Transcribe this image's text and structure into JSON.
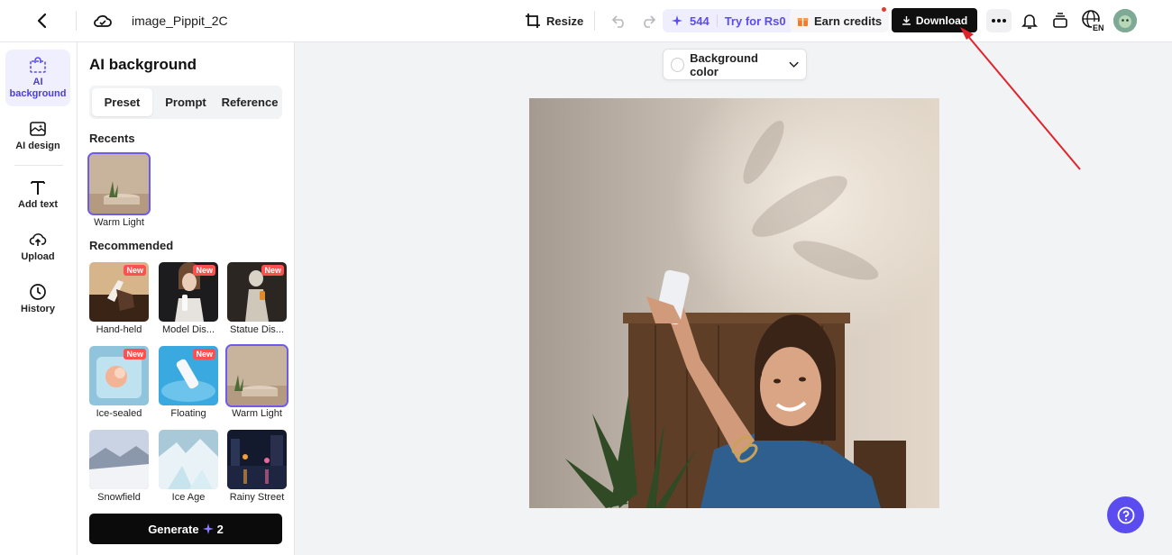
{
  "header": {
    "filename": "image_Pippit_2C",
    "resize_label": "Resize",
    "credits_count": "544",
    "try_label": "Try for Rs0",
    "earn_label": "Earn credits",
    "download_label": "Download"
  },
  "rail": {
    "items": [
      {
        "label_line1": "AI",
        "label_line2": "background"
      },
      {
        "label": "AI design"
      },
      {
        "label": "Add text"
      },
      {
        "label": "Upload"
      },
      {
        "label": "History"
      }
    ]
  },
  "panel": {
    "title": "AI background",
    "tabs": [
      "Preset",
      "Prompt",
      "Reference"
    ],
    "recents_heading": "Recents",
    "recent_item": "Warm Light",
    "recommended_heading": "Recommended",
    "new_badge": "New",
    "presets": [
      "Hand-held",
      "Model Dis...",
      "Statue Dis...",
      "Ice-sealed",
      "Floating",
      "Warm Light",
      "Snowfield",
      "Ice Age",
      "Rainy Street"
    ],
    "generate_label": "Generate",
    "generate_cost": "2"
  },
  "canvas": {
    "bgcolor_label": "Background color"
  },
  "lang": "EN",
  "colors": {
    "accent": "#5b4cf0",
    "download_bg": "#0f0f10",
    "annotation_arrow": "#e0242b"
  }
}
